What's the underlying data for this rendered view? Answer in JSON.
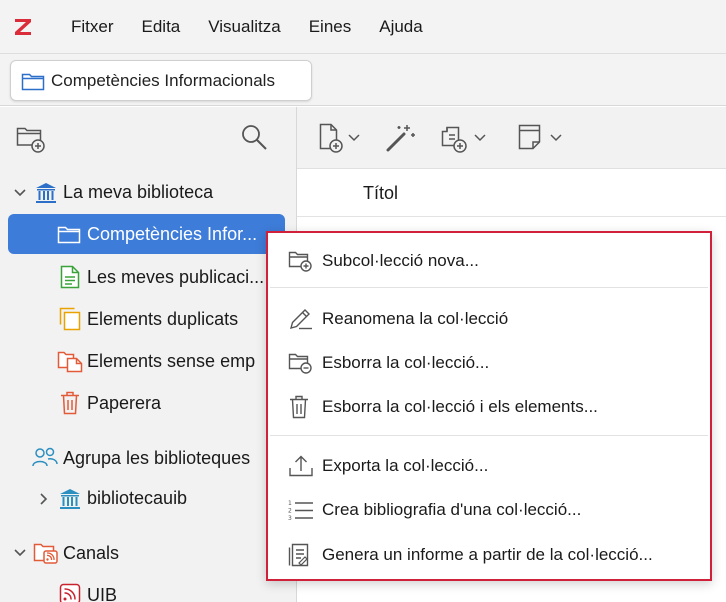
{
  "menubar": {
    "items": [
      "Fitxer",
      "Edita",
      "Visualitza",
      "Eines",
      "Ajuda"
    ],
    "logo_color": "#db2c3a"
  },
  "tab": {
    "label": "Competències Informacionals"
  },
  "tree": {
    "my_library": "La meva biblioteca",
    "collection_selected": "Competències Infor...",
    "my_publications": "Les meves publicaci...",
    "duplicates": "Elements duplicats",
    "unfiled": "Elements sense emp",
    "trash": "Paperera",
    "group_libraries": "Agrupa les biblioteques",
    "group_item": "bibliotecauib",
    "feeds": "Canals",
    "feed_item": "UIB"
  },
  "items_pane": {
    "column_title": "Títol"
  },
  "context_menu": {
    "new_subcollection": "Subcol·lecció nova...",
    "rename": "Reanomena la col·lecció",
    "delete": "Esborra la col·lecció...",
    "delete_with_items": "Esborra la col·lecció i els elements...",
    "export": "Exporta la col·lecció...",
    "bibliography": "Crea bibliografia d'una col·lecció...",
    "report": "Genera un informe a partir de la col·lecció..."
  },
  "colors": {
    "selection": "#3d7cd9",
    "menu_border": "#d0203a",
    "library_icon": "#2b6fc9",
    "publications_icon": "#3aa23a",
    "duplicates_icon": "#e9a200",
    "unfiled_icon": "#e25b39",
    "trash_icon": "#e25b39",
    "feeds_icon": "#e25b39"
  }
}
